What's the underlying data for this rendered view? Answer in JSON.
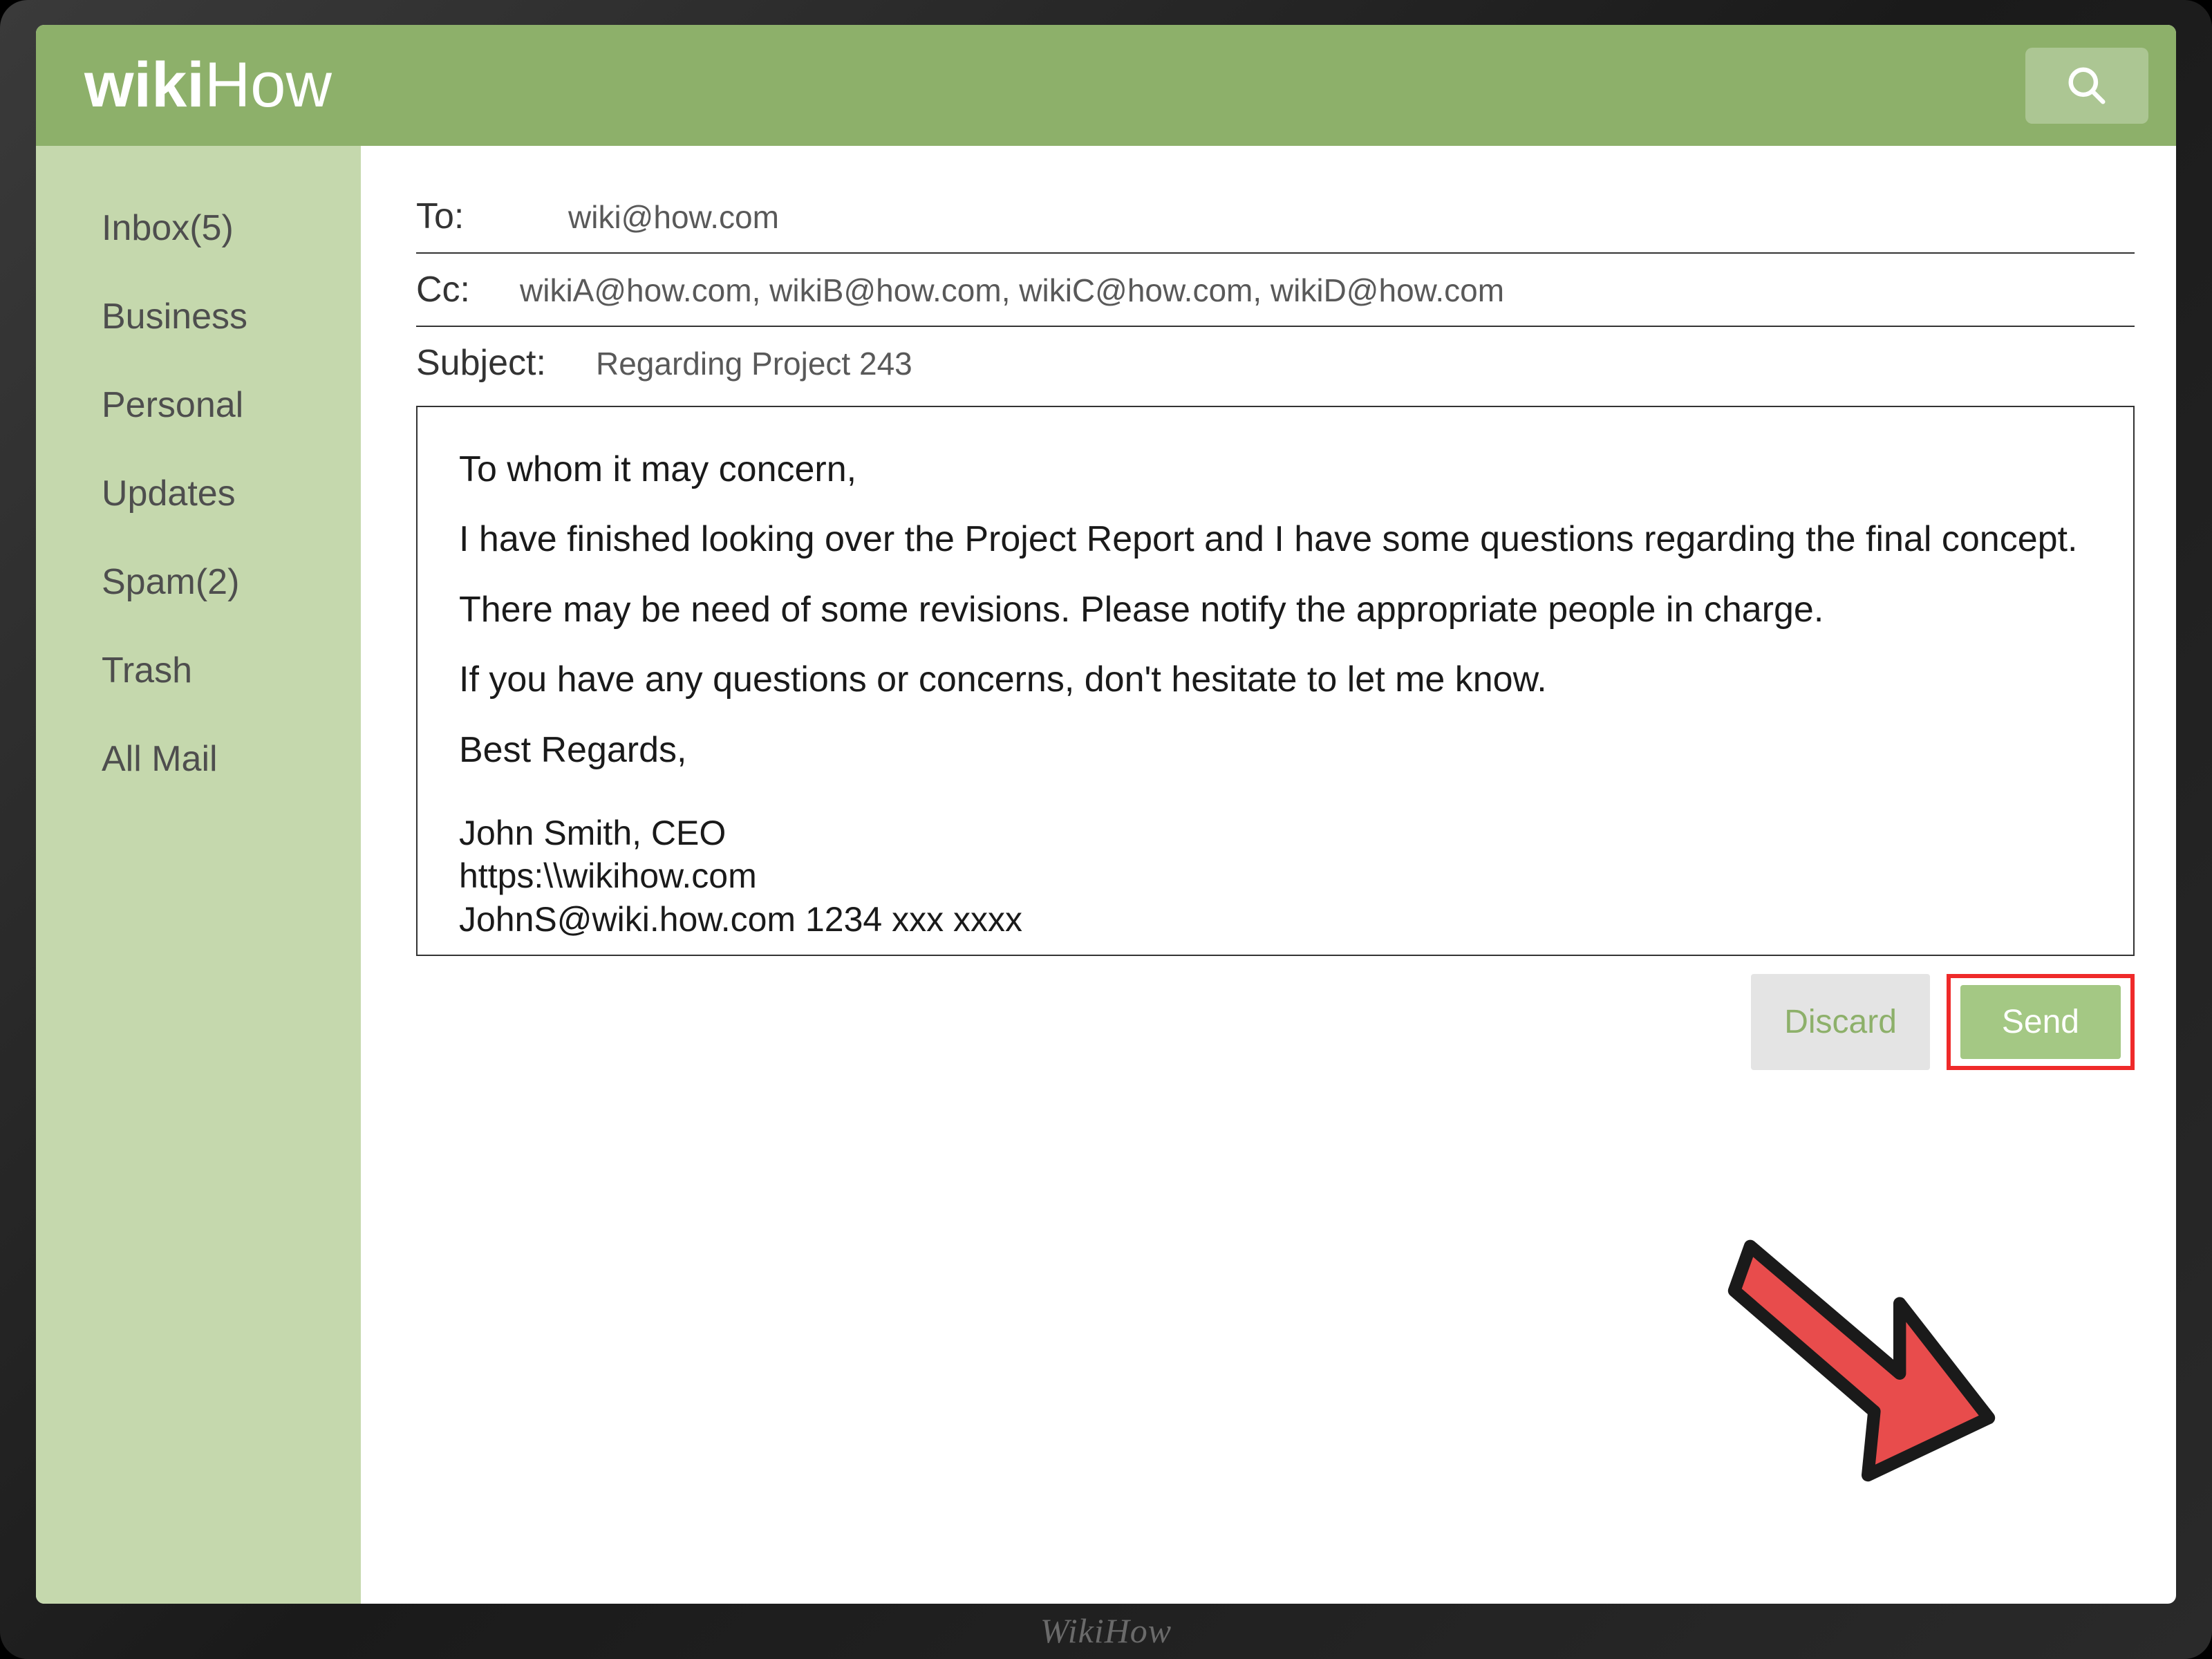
{
  "header": {
    "logo_wiki": "wiki",
    "logo_how": "How"
  },
  "sidebar": {
    "items": [
      {
        "label": "Inbox(5)"
      },
      {
        "label": "Business"
      },
      {
        "label": "Personal"
      },
      {
        "label": "Updates"
      },
      {
        "label": "Spam(2)"
      },
      {
        "label": "Trash"
      },
      {
        "label": "All Mail"
      }
    ]
  },
  "compose": {
    "to_label": "To:",
    "to_value": "wiki@how.com",
    "cc_label": "Cc:",
    "cc_value": "wikiA@how.com, wikiB@how.com, wikiC@how.com, wikiD@how.com",
    "subject_label": "Subject:",
    "subject_value": "Regarding Project 243",
    "body_greeting": "To whom it may concern,",
    "body_p1": "I have finished looking over the Project Report and I have some questions regarding the final concept. There may be need of some revisions. Please notify the appropriate people in charge.",
    "body_p2": "If you have any questions or concerns, don't hesitate to let me know.",
    "body_closing": "Best Regards,",
    "sig_name": "John Smith, CEO",
    "sig_url": "https:\\\\wikihow.com",
    "sig_contact": "JohnS@wiki.how.com  1234 xxx xxxx"
  },
  "buttons": {
    "discard": "Discard",
    "send": "Send"
  },
  "watermark": "WikiHow"
}
